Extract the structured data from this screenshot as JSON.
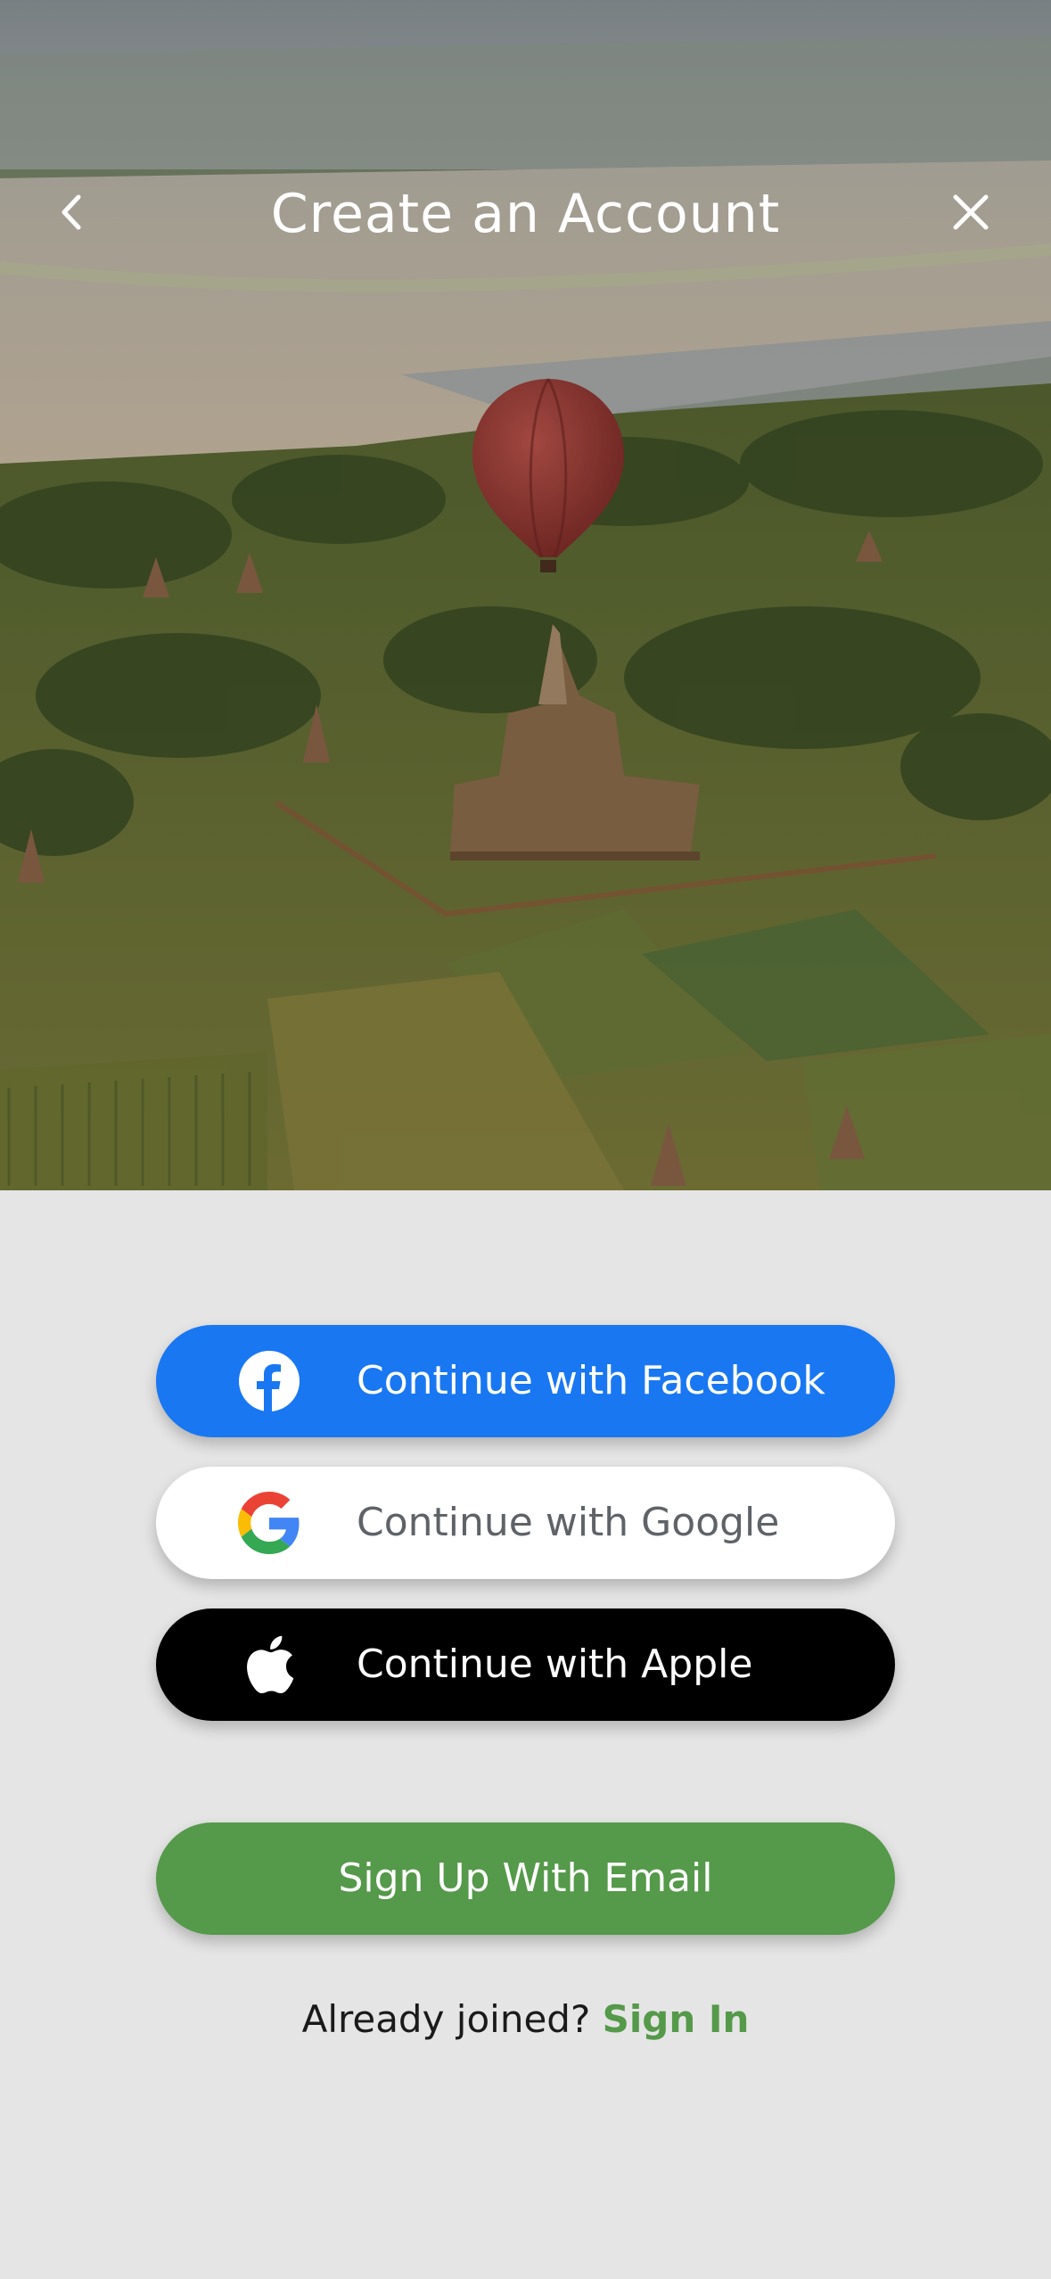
{
  "header": {
    "title": "Create an Account",
    "back_icon": "chevron-left-icon",
    "close_icon": "close-icon"
  },
  "hero": {
    "description_icon": "hot-air-balloon-landscape-photo"
  },
  "buttons": {
    "facebook": {
      "label": "Continue with Facebook",
      "icon": "facebook-icon",
      "color": "#1977f2"
    },
    "google": {
      "label": "Continue with Google",
      "icon": "google-icon",
      "color": "#ffffff"
    },
    "apple": {
      "label": "Continue with Apple",
      "icon": "apple-icon",
      "color": "#000000"
    },
    "email": {
      "label": "Sign Up With Email",
      "color": "#55994a"
    }
  },
  "footer": {
    "prompt": "Already joined?",
    "signin_label": "Sign In",
    "signin_color": "#55994a"
  }
}
